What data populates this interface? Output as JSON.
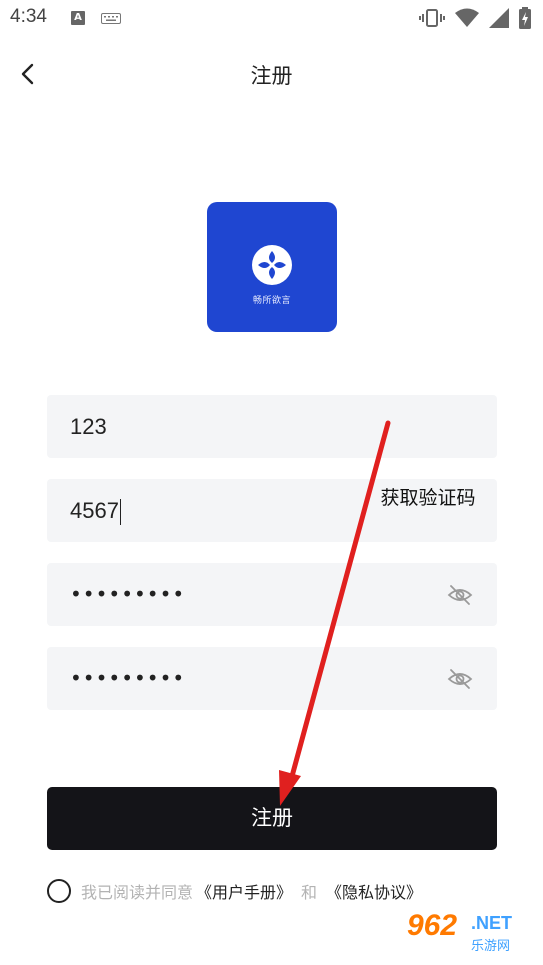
{
  "status_bar": {
    "time": "4:34",
    "a_icon_letter": "A",
    "icons": [
      "text-input-icon",
      "keyboard-icon",
      "vibrate-icon",
      "wifi-icon",
      "signal-icon",
      "battery-charging-icon"
    ]
  },
  "nav": {
    "title": "注册",
    "back_icon": "chevron-left-icon"
  },
  "logo": {
    "caption": "畅所欲言",
    "bg_color": "#1f46d1"
  },
  "form": {
    "field1_value": "123",
    "field2_value": "4567",
    "get_code_label": "获取验证码",
    "password_dots": "•••••••••",
    "confirm_dots": "•••••••••",
    "eye_icon": "eye-off-icon"
  },
  "submit": {
    "label": "注册",
    "bg_color": "#141418"
  },
  "agreement": {
    "prefix": "我已阅读并同意",
    "user_manual": "《用户手册》",
    "and": "和",
    "privacy": "《隐私协议》"
  },
  "watermark": {
    "number": "962",
    "suffix": ".NET",
    "cn": "乐游网"
  }
}
